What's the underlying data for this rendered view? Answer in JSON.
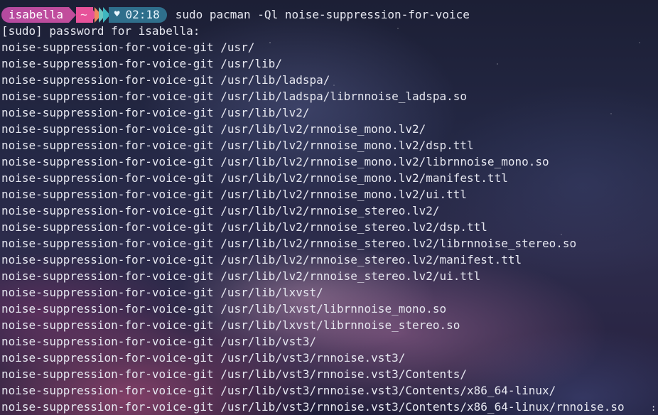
{
  "prompt": {
    "user": "isabella",
    "directory": "~",
    "time": "02:18",
    "heart_icon": "heart-icon",
    "command": "sudo pacman -Ql noise-suppression-for-voice"
  },
  "colors": {
    "user_segment": "#c24d9c",
    "dir_segment": "#e7529a",
    "time_segment": "#2f6f8c",
    "text": "#e6e7f0"
  },
  "sudo_line": "[sudo] password for isabella:",
  "output_lines": [
    "noise-suppression-for-voice-git /usr/",
    "noise-suppression-for-voice-git /usr/lib/",
    "noise-suppression-for-voice-git /usr/lib/ladspa/",
    "noise-suppression-for-voice-git /usr/lib/ladspa/librnnoise_ladspa.so",
    "noise-suppression-for-voice-git /usr/lib/lv2/",
    "noise-suppression-for-voice-git /usr/lib/lv2/rnnoise_mono.lv2/",
    "noise-suppression-for-voice-git /usr/lib/lv2/rnnoise_mono.lv2/dsp.ttl",
    "noise-suppression-for-voice-git /usr/lib/lv2/rnnoise_mono.lv2/librnnoise_mono.so",
    "noise-suppression-for-voice-git /usr/lib/lv2/rnnoise_mono.lv2/manifest.ttl",
    "noise-suppression-for-voice-git /usr/lib/lv2/rnnoise_mono.lv2/ui.ttl",
    "noise-suppression-for-voice-git /usr/lib/lv2/rnnoise_stereo.lv2/",
    "noise-suppression-for-voice-git /usr/lib/lv2/rnnoise_stereo.lv2/dsp.ttl",
    "noise-suppression-for-voice-git /usr/lib/lv2/rnnoise_stereo.lv2/librnnoise_stereo.so",
    "noise-suppression-for-voice-git /usr/lib/lv2/rnnoise_stereo.lv2/manifest.ttl",
    "noise-suppression-for-voice-git /usr/lib/lv2/rnnoise_stereo.lv2/ui.ttl",
    "noise-suppression-for-voice-git /usr/lib/lxvst/",
    "noise-suppression-for-voice-git /usr/lib/lxvst/librnnoise_mono.so",
    "noise-suppression-for-voice-git /usr/lib/lxvst/librnnoise_stereo.so",
    "noise-suppression-for-voice-git /usr/lib/vst3/",
    "noise-suppression-for-voice-git /usr/lib/vst3/rnnoise.vst3/",
    "noise-suppression-for-voice-git /usr/lib/vst3/rnnoise.vst3/Contents/",
    "noise-suppression-for-voice-git /usr/lib/vst3/rnnoise.vst3/Contents/x86_64-linux/",
    "noise-suppression-for-voice-git /usr/lib/vst3/rnnoise.vst3/Contents/x86_64-linux/rnnoise.so"
  ]
}
